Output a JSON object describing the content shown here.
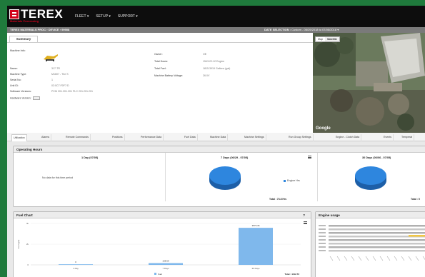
{
  "app": {
    "logo_text": "TEREX",
    "logo_sub": "Materials Processing",
    "nav": [
      "FLEET ▾",
      "SETUP ▾",
      "SUPPORT ▾"
    ]
  },
  "breadcrumb": {
    "path": "TEREX MATERIALS PROC › DEVICE › 99908",
    "date_label": "DATE SELECTION :",
    "date_value": "Custom - 06/29/2018 to 07/05/2018 ▾"
  },
  "summary": {
    "tab": "Summary",
    "left_fields": [
      {
        "label": "Machine Info:",
        "value": ""
      },
      {
        "label": "Name:",
        "value": "317-TR"
      },
      {
        "label": "Machine Type:",
        "value": "M1607 - The S"
      },
      {
        "label": "Serial No:",
        "value": "1"
      },
      {
        "label": "Unit ID:",
        "value": "02:0C7:F0F7:D"
      },
      {
        "label": "Software Versions:",
        "value": "PCM 201.201.201 PLC 201.201.201"
      },
      {
        "label": "Hardware Version:",
        "value": ""
      }
    ],
    "right_fields": [
      {
        "label": "Owner:",
        "value": "OE"
      },
      {
        "label": "Total Hours:",
        "value": "1543:22:12 Engine"
      },
      {
        "label": "Total Fuel:",
        "value": "1815.3919 Gallons (gal)"
      },
      {
        "label": "Machine Battery Voltage:",
        "value": "26.0V"
      }
    ]
  },
  "map": {
    "tabs": [
      "Map",
      "Satellite"
    ],
    "active_tab": "Satellite",
    "attribution": "Google"
  },
  "tabs": [
    "Utilization",
    "Alarms",
    "Remote Commands",
    "Positions",
    "Performance Data",
    "Fuel Data",
    "Machine Data",
    "Machine Settings",
    "Run Group Settings",
    "Engine - Clutch Data",
    "Events",
    "Temperat"
  ],
  "active_tab": "Utilization",
  "operating_hours": {
    "title": "Operating Hours",
    "columns": [
      {
        "title": "1 Day (07/05)",
        "no_data": "No data for this time period",
        "legend": "",
        "total": ""
      },
      {
        "title": "7 Days (06/29 - 07/05)",
        "no_data": "",
        "legend": "Engine Hrs",
        "total": "Total : 73.8 Hrs"
      },
      {
        "title": "30 Days (06/06 - 07/05)",
        "no_data": "",
        "legend": "",
        "total": "Total : 5"
      }
    ]
  },
  "fuel_chart": {
    "title": "Fuel Chart",
    "help": "?",
    "ylabel": "Fuel (gal)",
    "total_label": "Total : 4412.72",
    "legend": "Fuel"
  },
  "engine_usage": {
    "title": "Engine usage"
  },
  "chart_data": [
    {
      "type": "bar",
      "title": "Fuel Chart",
      "categories": [
        "1 Day",
        "7 Days",
        "30 Days"
      ],
      "values": [
        0,
        168.69,
        3579.36
      ],
      "value_labels": [
        "0",
        "168.69",
        "3579.36"
      ],
      "ylabel": "Fuel (gal)",
      "ylim": [
        0,
        4000
      ],
      "yticks": [
        "0",
        "2k",
        "4k"
      ],
      "colors": [
        "#7fb8ec"
      ]
    },
    {
      "type": "pie",
      "title": "7 Days (06/29 - 07/05)",
      "labels": [
        "Engine Hrs"
      ],
      "values": [
        73.8
      ],
      "colors": [
        "#2e86de"
      ]
    },
    {
      "type": "pie",
      "title": "30 Days (06/06 - 07/05)",
      "labels": [
        "Engine Hrs"
      ],
      "values": [
        1
      ],
      "colors": [
        "#2e86de"
      ]
    }
  ]
}
